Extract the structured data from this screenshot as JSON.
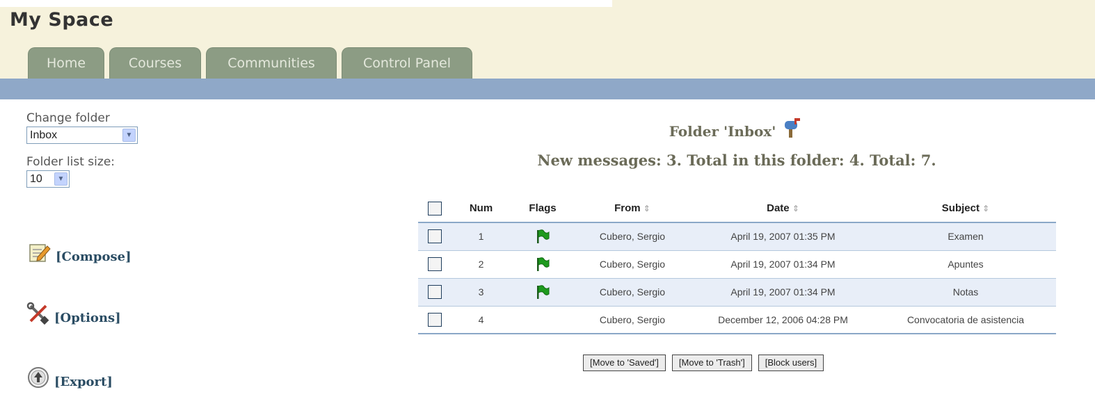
{
  "page": {
    "title": "My Space"
  },
  "tabs": [
    {
      "label": "Home"
    },
    {
      "label": "Courses"
    },
    {
      "label": "Communities"
    },
    {
      "label": "Control Panel"
    }
  ],
  "sidebar": {
    "change_folder_label": "Change folder",
    "folder_value": "Inbox",
    "list_size_label": "Folder list size:",
    "list_size_value": "10",
    "actions": [
      {
        "label": "[Compose]",
        "icon": "compose-icon"
      },
      {
        "label": "[Options]",
        "icon": "tools-icon"
      },
      {
        "label": "[Export]",
        "icon": "export-icon"
      }
    ]
  },
  "main": {
    "folder_heading": "Folder 'Inbox'",
    "counts": "New messages: 3. Total in this folder: 4. Total: 7.",
    "columns": [
      "Num",
      "Flags",
      "From",
      "Date",
      "Subject"
    ],
    "sort_glyph": "⇕",
    "rows": [
      {
        "num": "1",
        "flagged": true,
        "from": "Cubero, Sergio",
        "date": "April 19, 2007 01:35 PM",
        "subject": "Examen"
      },
      {
        "num": "2",
        "flagged": true,
        "from": "Cubero, Sergio",
        "date": "April 19, 2007 01:34 PM",
        "subject": "Apuntes"
      },
      {
        "num": "3",
        "flagged": true,
        "from": "Cubero, Sergio",
        "date": "April 19, 2007 01:34 PM",
        "subject": "Notas"
      },
      {
        "num": "4",
        "flagged": false,
        "from": "Cubero, Sergio",
        "date": "December 12, 2006 04:28 PM",
        "subject": "Convocatoria de asistencia"
      }
    ],
    "buttons": [
      "[Move to 'Saved']",
      "[Move to 'Trash']",
      "[Block users]"
    ]
  },
  "colors": {
    "header_bg": "#f6f2dc",
    "tab_bg": "#8c9c84",
    "blue_bar": "#8fa8c8",
    "link": "#2a4c63",
    "flag": "#1e9a1e"
  }
}
